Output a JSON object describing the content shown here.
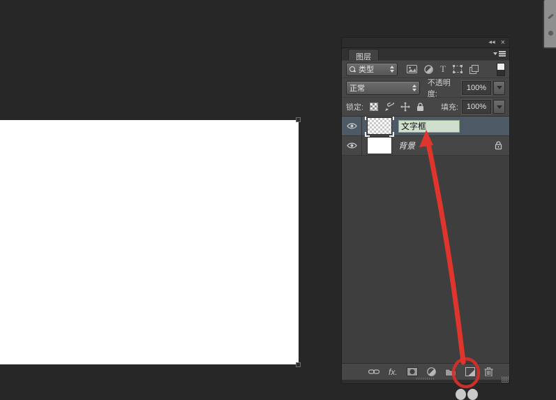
{
  "window": {
    "collapse_glyph": "◀◀",
    "close_glyph": "×"
  },
  "panel": {
    "tab_title": "图层",
    "filter": {
      "kind_label": "类型",
      "icons": [
        "pixel-layer-filter",
        "adjustment-layer-filter",
        "type-layer-filter",
        "shape-layer-filter",
        "smart-object-filter",
        "filter-toggle-switch"
      ],
      "type_filter_glyph": "T"
    },
    "blend": {
      "mode": "正常",
      "opacity_label": "不透明度:",
      "opacity_value": "100%"
    },
    "lock": {
      "label": "锁定:",
      "icons": [
        "lock-transparent-pixels",
        "lock-image-pixels",
        "lock-position",
        "lock-all"
      ],
      "fill_label": "填充:",
      "fill_value": "100%"
    },
    "layers": [
      {
        "name": "文字框",
        "state": "renaming",
        "thumbnail": "transparent-checkerboard",
        "visible": true,
        "selected": true
      },
      {
        "name": "背景",
        "state": "locked",
        "thumbnail": "white",
        "visible": true,
        "selected": false
      }
    ],
    "toolbar": {
      "fx_label": "fx.",
      "icons": [
        "link-layers-icon",
        "layer-style-icon",
        "layer-mask-icon",
        "adjustment-layer-icon",
        "new-group-icon",
        "new-layer-icon",
        "delete-layer-icon"
      ]
    }
  },
  "annotations": {
    "highlight_color": "#d32f24",
    "arrow_from": "new-layer-button",
    "arrow_to": "layer-name-field"
  },
  "colors": {
    "workspace_bg": "#272727",
    "panel_bg": "#464646",
    "selected_row": "#4d5a66",
    "name_field_bg": "#cfdecd",
    "canvas": "#ffffff"
  }
}
